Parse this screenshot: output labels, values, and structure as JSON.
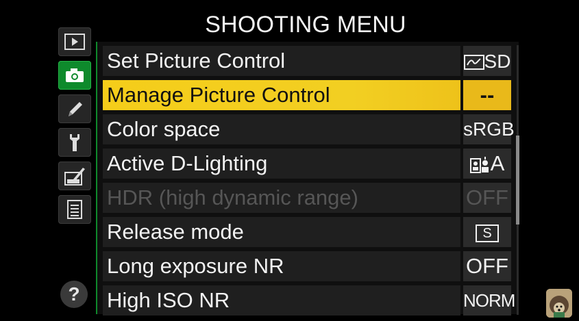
{
  "header": {
    "title": "SHOOTING MENU"
  },
  "tabs": [
    {
      "name": "playback-tab",
      "icon": "playback-icon",
      "active": false
    },
    {
      "name": "shooting-tab",
      "icon": "camera-icon",
      "active": true
    },
    {
      "name": "retouch-tab",
      "icon": "pencil-icon",
      "active": false
    },
    {
      "name": "setup-tab",
      "icon": "wrench-icon",
      "active": false
    },
    {
      "name": "retouch-menu-tab",
      "icon": "retouch-brush-icon",
      "active": false
    },
    {
      "name": "my-menu-tab",
      "icon": "list-icon",
      "active": false
    }
  ],
  "help": {
    "label": "?"
  },
  "menu": {
    "items": [
      {
        "label": "Set Picture Control",
        "value": "SD"
      },
      {
        "label": "Manage Picture Control",
        "value": "--"
      },
      {
        "label": "Color space",
        "value": "sRGB"
      },
      {
        "label": "Active D-Lighting",
        "value": "A"
      },
      {
        "label": "HDR (high dynamic range)",
        "value": "OFF"
      },
      {
        "label": "Release mode",
        "value": "S"
      },
      {
        "label": "Long exposure NR",
        "value": "OFF"
      },
      {
        "label": "High ISO NR",
        "value": "NORM"
      }
    ],
    "selected_index": 1,
    "disabled_index": 4
  },
  "colors": {
    "accent_green": "#0e8a2c",
    "highlight_yellow": "#f5cd1a",
    "disabled_text": "#565656"
  }
}
